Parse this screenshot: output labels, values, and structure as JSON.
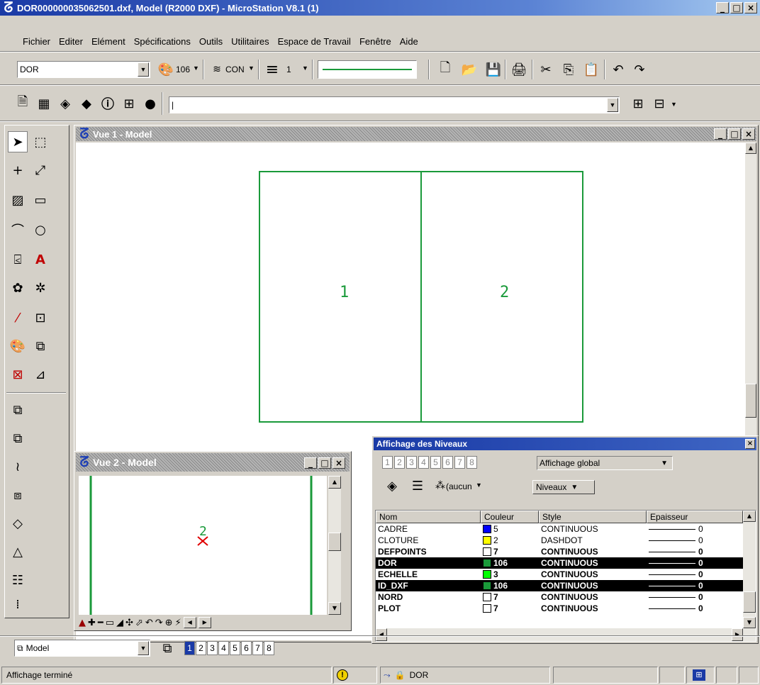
{
  "window": {
    "title": "DOR000000035062501.dxf, Model (R2000 DXF) - MicroStation V8.1 (1)",
    "logo": "microstation-logo"
  },
  "menu": [
    "Fichier",
    "Editer",
    "Elément",
    "Spécifications",
    "Outils",
    "Utilitaires",
    "Espace de Travail",
    "Fenêtre",
    "Aide"
  ],
  "attributes": {
    "level": "DOR",
    "color": "106",
    "style_label": "CON",
    "weight": "1"
  },
  "toolbar2": {
    "keyin_value": "|"
  },
  "view1": {
    "title": "Vue 1 - Model",
    "label_left": "1",
    "label_right": "2"
  },
  "view2": {
    "title": "Vue 2 - Model",
    "label": "2"
  },
  "levels_dialog": {
    "title": "Affichage des Niveaux",
    "view_numbers": [
      "1",
      "2",
      "3",
      "4",
      "5",
      "6",
      "7",
      "8"
    ],
    "display_mode": "Affichage global",
    "filter_label": "(aucun",
    "niveaux_label": "Niveaux",
    "columns": [
      "Nom",
      "Couleur",
      "Style",
      "Epaisseur"
    ],
    "rows": [
      {
        "name": "CADRE",
        "color": "5",
        "hex": "#0000ff",
        "style": "CONTINUOUS",
        "weight": "0",
        "selected": false,
        "bold": false
      },
      {
        "name": "CLOTURE",
        "color": "2",
        "hex": "#ffff00",
        "style": "DASHDOT",
        "weight": "0",
        "selected": false,
        "bold": false
      },
      {
        "name": "DEFPOINTS",
        "color": "7",
        "hex": "#ffffff",
        "style": "CONTINUOUS",
        "weight": "0",
        "selected": false,
        "bold": true
      },
      {
        "name": "DOR",
        "color": "106",
        "hex": "#1a9a3a",
        "style": "CONTINUOUS",
        "weight": "0",
        "selected": true,
        "bold": true
      },
      {
        "name": "ECHELLE",
        "color": "3",
        "hex": "#00ff00",
        "style": "CONTINUOUS",
        "weight": "0",
        "selected": false,
        "bold": true
      },
      {
        "name": "ID_DXF",
        "color": "106",
        "hex": "#1a9a3a",
        "style": "CONTINUOUS",
        "weight": "0",
        "selected": true,
        "bold": true
      },
      {
        "name": "NORD",
        "color": "7",
        "hex": "#ffffff",
        "style": "CONTINUOUS",
        "weight": "0",
        "selected": false,
        "bold": true
      },
      {
        "name": "PLOT",
        "color": "7",
        "hex": "#ffffff",
        "style": "CONTINUOUS",
        "weight": "0",
        "selected": false,
        "bold": true
      }
    ]
  },
  "bottom": {
    "model": "Model",
    "view_buttons": [
      "1",
      "2",
      "3",
      "4",
      "5",
      "6",
      "7",
      "8"
    ]
  },
  "status": {
    "message": "Affichage terminé",
    "level": "DOR"
  },
  "colors": {
    "geometry": "#1a9a3a",
    "title_active": "#1a3aa6"
  }
}
